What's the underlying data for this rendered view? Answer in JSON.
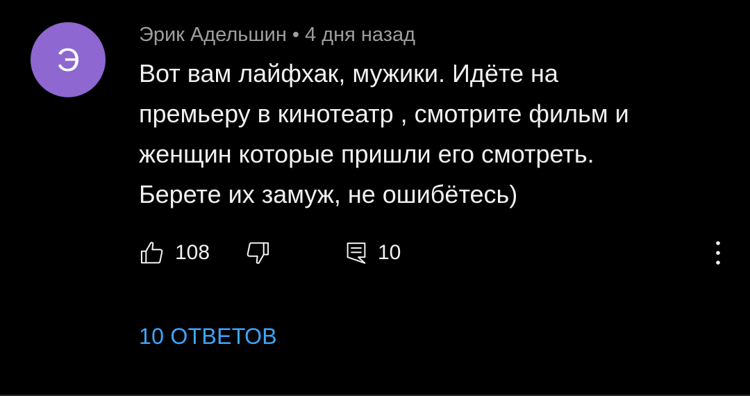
{
  "comment": {
    "avatar_letter": "Э",
    "avatar_color": "#8e67d0",
    "author": "Эрик Адельшин",
    "separator": "•",
    "time_ago": "4 дня назад",
    "text_lines": [
      "Вот вам лайфхак, мужики. Идёте на",
      "премьеру в кинотеатр , смотрите фильм и",
      "женщин которые пришли его смотреть.",
      "Берете их замуж, не ошибётесь)"
    ],
    "likes": "108",
    "reply_count": "10",
    "replies_link": "10 ОТВЕТОВ",
    "link_color": "#3ea6ff"
  },
  "icons": {
    "like": "thumbs-up-icon",
    "dislike": "thumbs-down-icon",
    "reply": "reply-comment-icon",
    "more": "more-vertical-icon"
  }
}
